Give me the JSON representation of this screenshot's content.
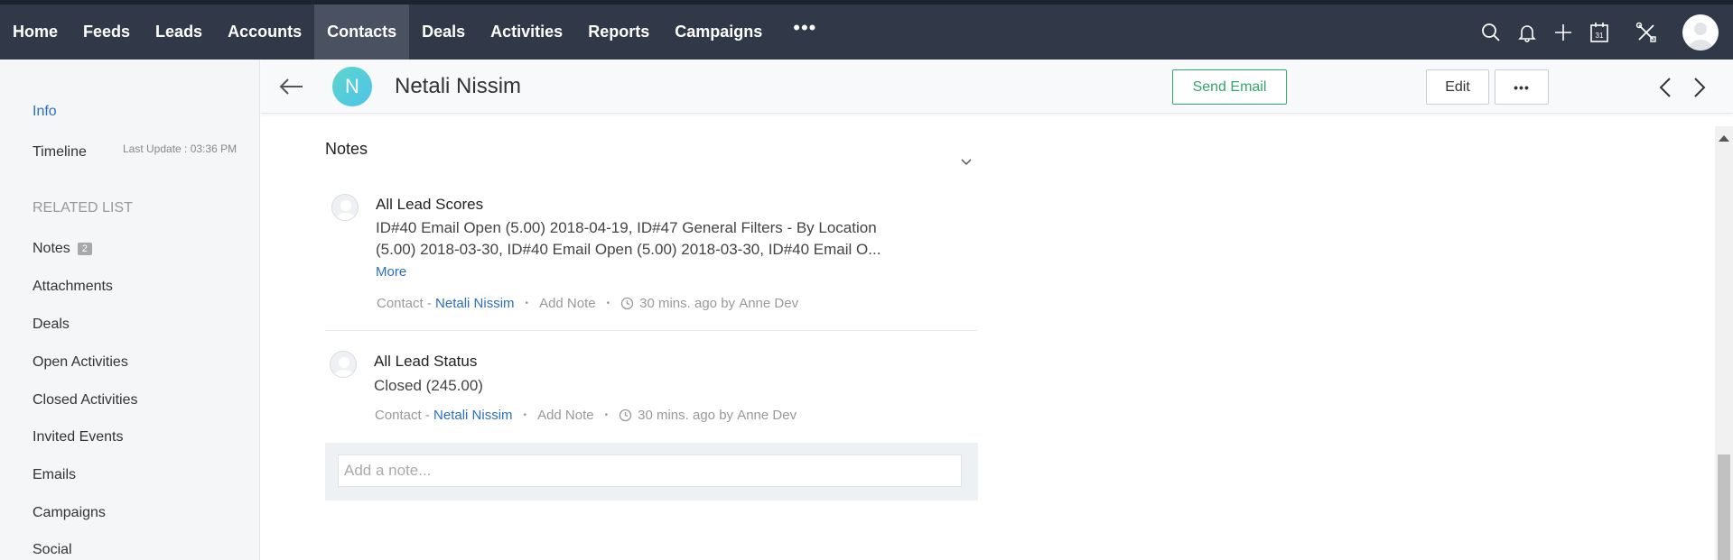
{
  "nav": {
    "items": [
      {
        "label": "Home",
        "active": false
      },
      {
        "label": "Feeds",
        "active": false
      },
      {
        "label": "Leads",
        "active": false
      },
      {
        "label": "Accounts",
        "active": false
      },
      {
        "label": "Contacts",
        "active": true
      },
      {
        "label": "Deals",
        "active": false
      },
      {
        "label": "Activities",
        "active": false
      },
      {
        "label": "Reports",
        "active": false
      },
      {
        "label": "Campaigns",
        "active": false
      }
    ],
    "more": "•••",
    "icons": [
      "search-icon",
      "bell-icon",
      "plus-icon",
      "calendar-icon",
      "setup-tools-icon",
      "user-avatar"
    ],
    "calendar_day": "31"
  },
  "sidebar": {
    "info": "Info",
    "timeline": "Timeline",
    "last_update": "Last Update : 03:36 PM",
    "related_list_heading": "RELATED LIST",
    "related": [
      {
        "label": "Notes",
        "badge": "2"
      },
      {
        "label": "Attachments"
      },
      {
        "label": "Deals"
      },
      {
        "label": "Open Activities"
      },
      {
        "label": "Closed Activities"
      },
      {
        "label": "Invited Events"
      },
      {
        "label": "Emails"
      },
      {
        "label": "Campaigns"
      },
      {
        "label": "Social"
      }
    ]
  },
  "header": {
    "avatar_initial": "N",
    "contact_name": "Netali Nissim",
    "send_email": "Send Email",
    "edit": "Edit",
    "more": "•••"
  },
  "notes": {
    "title": "Notes",
    "items": [
      {
        "title": "All Lead Scores",
        "body": "ID#40 Email Open (5.00) 2018-04-19, ID#47 General Filters - By Location (5.00) 2018-03-30, ID#40 Email Open (5.00) 2018-03-30, ID#40 Email O...",
        "more": "More",
        "module": "Contact -",
        "contact": "Netali Nissim",
        "add_note": "Add Note",
        "time": "30 mins. ago",
        "by": "by",
        "author": "Anne Dev"
      },
      {
        "title": "All Lead Status",
        "body": "Closed (245.00)",
        "module": "Contact -",
        "contact": "Netali Nissim",
        "add_note": "Add Note",
        "time": "30 mins. ago",
        "by": "by",
        "author": "Anne Dev"
      }
    ],
    "add_placeholder": "Add a note..."
  },
  "colors": {
    "nav_bg": "#313949",
    "nav_active": "#4a5262",
    "link": "#2b6fc4",
    "send_email": "#2fa86a"
  }
}
